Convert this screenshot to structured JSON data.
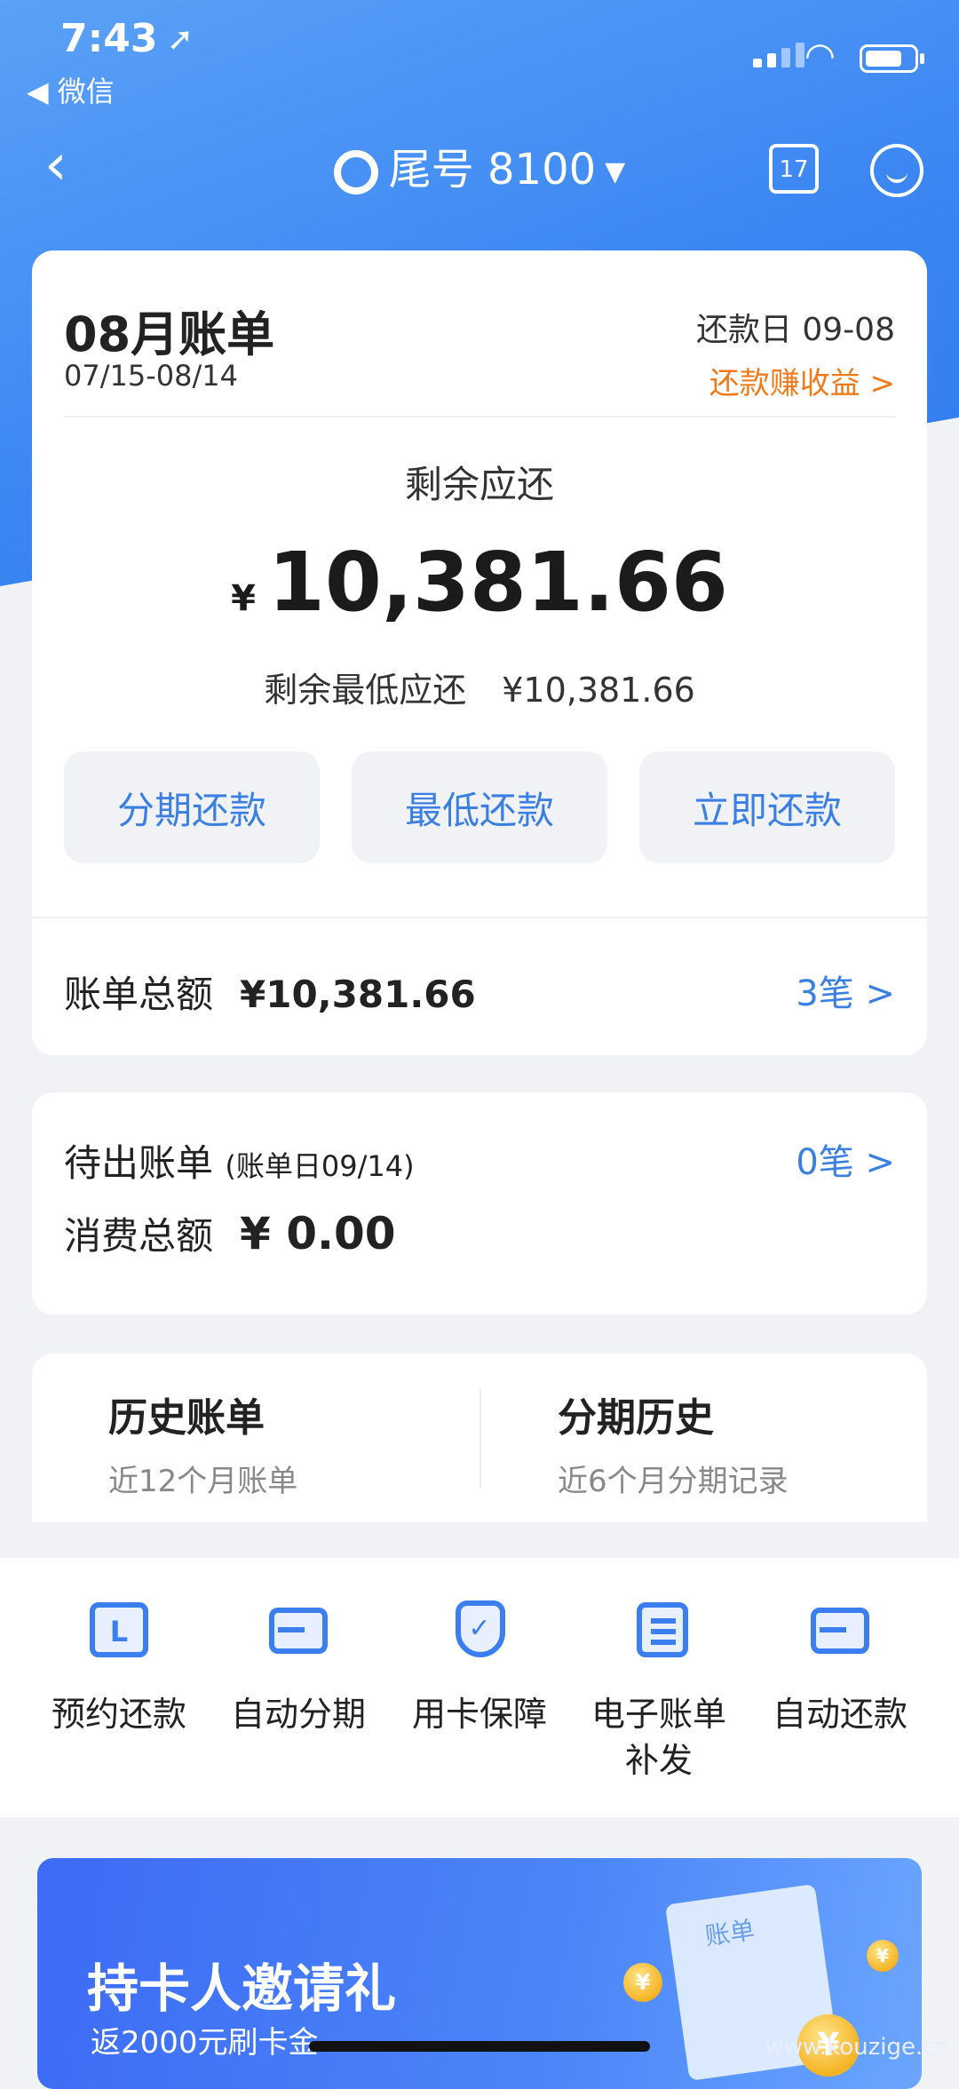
{
  "status": {
    "time": "7:43",
    "back_app": "◀ 微信"
  },
  "nav": {
    "title": "尾号 8100",
    "calendar_day": "17"
  },
  "bill": {
    "month": "08月账单",
    "period": "07/15-08/14",
    "due_date": "还款日 09-08",
    "earn_link": "还款赚收益 >",
    "remaining_label": "剩余应还",
    "currency": "¥",
    "remaining_amount": "10,381.66",
    "min_label": "剩余最低应还",
    "min_amount": "¥10,381.66",
    "buttons": [
      "分期还款",
      "最低还款",
      "立即还款"
    ],
    "total_label": "账单总额",
    "total_amount": "¥10,381.66",
    "total_count": "3笔 >"
  },
  "pending": {
    "label": "待出账单",
    "statement_day": "(账单日09/14)",
    "count": "0笔 >",
    "spend_label": "消费总额",
    "spend_amount": "¥ 0.00"
  },
  "history": [
    {
      "title": "历史账单",
      "subtitle": "近12个月账单"
    },
    {
      "title": "分期历史",
      "subtitle": "近6个月分期记录"
    }
  ],
  "tools": [
    {
      "label": "预约还款",
      "icon": "calendar-l-icon"
    },
    {
      "label": "自动分期",
      "icon": "card-cycle-icon"
    },
    {
      "label": "用卡保障",
      "icon": "shield-check-icon"
    },
    {
      "label": "电子账单\n补发",
      "icon": "document-icon"
    },
    {
      "label": "自动还款",
      "icon": "card-cycle-icon"
    }
  ],
  "banner": {
    "title": "持卡人邀请礼",
    "subtitle": "返2000元刷卡金",
    "paper_text": "账单",
    "coin_symbol": "¥"
  },
  "watermark": "www.kouzige.cn",
  "colors": {
    "accent_blue": "#3b7fe3",
    "orange": "#f07a1a",
    "hero": "#3c86f3"
  }
}
